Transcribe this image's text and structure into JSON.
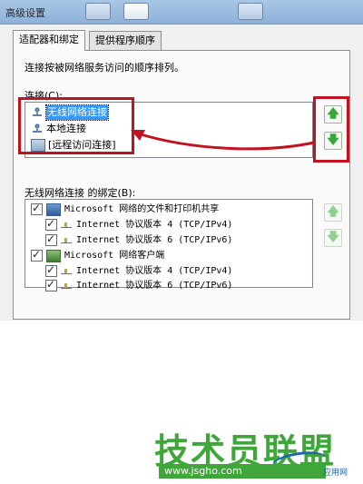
{
  "window": {
    "title": "高级设置"
  },
  "tabs": [
    {
      "label": "适配器和绑定",
      "active": true
    },
    {
      "label": "提供程序顺序",
      "active": false
    }
  ],
  "instruction": "连接按被网络服务访问的顺序排列。",
  "connections": {
    "label": "连接(C):",
    "items": [
      {
        "name": "无线网络连接",
        "selected": true,
        "icon": "network-connection-icon"
      },
      {
        "name": "本地连接",
        "selected": false,
        "icon": "network-connection-icon"
      },
      {
        "name": "[远程访问连接]",
        "selected": false,
        "icon": "remote-access-icon"
      }
    ],
    "move_up": "up-arrow-icon",
    "move_down": "down-arrow-icon"
  },
  "bindings": {
    "label": "无线网络连接 的绑定(B):",
    "groups": [
      {
        "name": "Microsoft 网络的文件和打印机共享",
        "checked": true,
        "icon": "file-print-sharing-icon",
        "children": [
          {
            "name": "Internet 协议版本 4 (TCP/IPv4)",
            "checked": true
          },
          {
            "name": "Internet 协议版本 6 (TCP/IPv6)",
            "checked": true
          }
        ]
      },
      {
        "name": "Microsoft 网络客户端",
        "checked": true,
        "icon": "network-client-icon",
        "children": [
          {
            "name": "Internet 协议版本 4 (TCP/IPv4)",
            "checked": true
          },
          {
            "name": "Internet 协议版本 6 (TCP/IPv6)",
            "checked": true
          }
        ]
      }
    ]
  },
  "watermark": {
    "brand": "技术员联盟",
    "url": "www.jsgho.com",
    "tag": "应用网"
  },
  "colors": {
    "highlight": "#c1121f",
    "selection": "#3399ff",
    "watermark": "#3fa63a",
    "arrow": "#3aa63a"
  }
}
